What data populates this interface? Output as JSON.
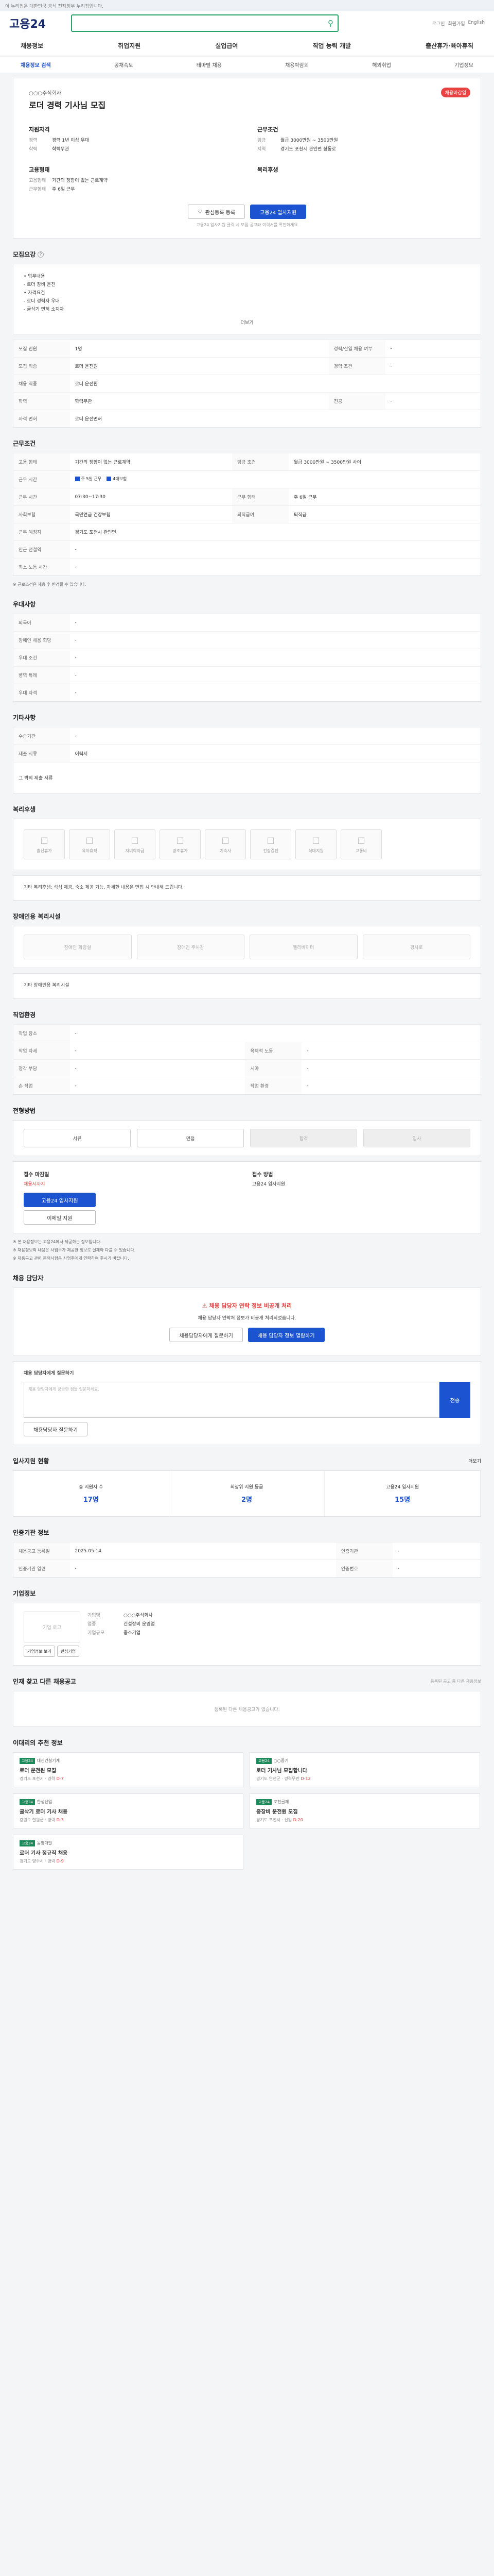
{
  "top_note": "이 누리집은 대한민국 공식 전자정부 누리집입니다.",
  "header": {
    "logo": "고용24",
    "util": [
      "로그인",
      "회원가입",
      "English"
    ]
  },
  "menu": [
    "채용정보",
    "취업지원",
    "실업급여",
    "직업 능력 개발",
    "출산휴가·육아휴직"
  ],
  "submenu": [
    "채용정보 검색",
    "공채속보",
    "테마별 채용",
    "채용박람회",
    "해외취업",
    "기업정보"
  ],
  "job": {
    "company": "○○○주식회사",
    "title": "로더 경력 기사님 모집",
    "badge": "채용마감일",
    "summary_left_title": "지원자격",
    "summary_right_title": "근무조건",
    "left": [
      {
        "k": "경력",
        "v": "경력 1년 이상 우대"
      },
      {
        "k": "학력",
        "v": "학력무관"
      }
    ],
    "right": [
      {
        "k": "임금",
        "v": "월급 3000만원 ~ 3500만원"
      },
      {
        "k": "지역",
        "v": "경기도 포천시 관인면 창동로"
      }
    ],
    "employ_title": "고용형태",
    "welfare_title": "복리후생",
    "employ": [
      {
        "k": "고용형태",
        "v": "기간의 정함이 없는 근로계약"
      },
      {
        "k": "근무형태",
        "v": "주 6일 근무"
      }
    ],
    "btn_save": "관심등록 등록",
    "btn_apply": "고용24 입사지원",
    "small": "고용24 입사지원 클릭 시 모집 공고와 이력서를 확인하세요"
  },
  "sections": {
    "recruit": "모집요강",
    "work": "근무조건",
    "detail": "우대사항",
    "other": "기타사항",
    "welfare": "복리후생",
    "disabled": "장애인용 복리시설",
    "contact": "직업환경",
    "process": "전형방법",
    "manager": "채용 담당자",
    "stat": "입사지원 현황",
    "info": "인증기관 정보",
    "corp": "기업정보",
    "others": "인재 찾고 다른 채용공고",
    "rec": "이대리의 추천 정보"
  },
  "recruit": {
    "list": [
      "• 업무내용",
      "  - 로더 장비 운전",
      "• 자격요건",
      "  - 로더 경력자 우대",
      "  - 굴삭기 면허 소지자"
    ],
    "more": "더보기",
    "rows": [
      [
        "모집 인원",
        "1명",
        "경력/신입 채용 여부",
        "-"
      ],
      [
        "모집 직종",
        "로더 운전원",
        "경력 조건",
        "-"
      ],
      [
        "채용 직종",
        "로더 운전원",
        "",
        ""
      ],
      [
        "학력",
        "학력무관",
        "전공",
        "-"
      ],
      [
        "자격 면허",
        "로더 운전면허",
        "",
        ""
      ]
    ]
  },
  "work": {
    "rows": [
      [
        "고용 형태",
        "기간의 정함이 없는 근로계약",
        "임금 조건",
        "월급 3000만원 ~ 3500만원 사이"
      ],
      [
        "근무 시간",
        "주 6일 근무",
        "",
        ""
      ],
      [
        "근무 시간",
        "07:30~17:30",
        "근무 형태",
        "주 6일 근무"
      ],
      [
        "사회보험",
        "국민연금 건강보험",
        "퇴직급여",
        "퇴직금"
      ],
      [
        "근무 예정지",
        "경기도 포천시 관인면",
        "",
        ""
      ],
      [
        "인근 전철역",
        "-",
        "",
        ""
      ],
      [
        "최소 노동 시간",
        "-",
        "",
        ""
      ]
    ],
    "note": "※ 근로조건은 채용 후 변경될 수 있습니다.",
    "chip1": "주 5일 근무",
    "chip2": "4대보험"
  },
  "detail": {
    "rows": [
      [
        "외국어",
        "-"
      ],
      [
        "장애인 채용 희망",
        "-"
      ],
      [
        "우대 조건",
        "-"
      ],
      [
        "병역 특례",
        "-"
      ],
      [
        "우대 자격",
        "-"
      ]
    ]
  },
  "other": {
    "rows": [
      [
        "수습기간",
        "-"
      ],
      [
        "제출 서류",
        "이력서"
      ]
    ],
    "extra": "그 밖의 제출 서류"
  },
  "welfare": {
    "icons": [
      "출산휴가",
      "육아휴직",
      "자녀학자금",
      "경조휴가",
      "기숙사",
      "건강검진",
      "식대지원",
      "교통비"
    ],
    "desc": "기타 복리후생: 석식 제공, 숙소 제공 가능. 자세한 내용은 면접 시 안내해 드립니다."
  },
  "disabled": {
    "icons": [
      "장애인 화장실",
      "장애인 주차장",
      "엘리베이터",
      "경사로"
    ],
    "note": "기타 장애인용 복리시설"
  },
  "contact": {
    "rows": [
      [
        "작업 장소",
        "-",
        "",
        ""
      ],
      [
        "작업 자세",
        "-",
        "육체적 노동",
        "-"
      ],
      [
        "청각 부담",
        "-",
        "시야",
        "-"
      ],
      [
        "손 작업",
        "-",
        "작업 환경",
        "-"
      ]
    ]
  },
  "process": {
    "steps": [
      "서류",
      "면접",
      "합격",
      "입사"
    ],
    "apply_title": "접수 마감일",
    "apply_text": "채용시까지",
    "method_title": "접수 방법",
    "method": "고용24 입사지원",
    "btn": "고용24 입사지원",
    "btn2": "이메일 지원",
    "notes": [
      "※ 본 채용정보는 고용24에서 제공하는 정보입니다.",
      "※ 채용정보의 내용은 사업주가 제공한 정보로 실제와 다를 수 있습니다.",
      "※ 채용공고 관련 문의사항은 사업주에게 연락하여 주시기 바랍니다."
    ]
  },
  "manager": {
    "warn": "채용 담당자 연락 정보 비공개 처리",
    "text": "채용 담당자 연락처 정보가 비공개 처리되었습니다.",
    "btn1": "채용담당자에게 질문하기",
    "btn2": "채용 담당자 정보 열람하기"
  },
  "qa": {
    "title": "채용 담당자에게 질문하기",
    "placeholder": "채용 담당자에게 궁금한 점을 질문하세요.",
    "submit": "전송",
    "btn": "채용담당자 질문하기"
  },
  "stat": {
    "more": "더보기",
    "items": [
      {
        "k": "총 지원자 수",
        "v": "17명"
      },
      {
        "k": "최상위 지원 등급",
        "v": "2명"
      },
      {
        "k": "고용24 입사지원",
        "v": "15명"
      }
    ]
  },
  "info": {
    "rows": [
      [
        "채용공고 등록일",
        "2025.05.14",
        "인증기관",
        "-"
      ],
      [
        "인증기관 일련",
        "-",
        "인증번호",
        "-"
      ]
    ]
  },
  "corp": {
    "logo": "기업 로고",
    "btn1": "기업정보 보기",
    "btn2": "관심기업",
    "rows": [
      [
        "기업명",
        "○○○주식회사"
      ],
      [
        "업종",
        "건설장비 운영업"
      ],
      [
        "기업규모",
        "중소기업"
      ]
    ]
  },
  "others": {
    "text": "등록된 다른 채용공고가 없습니다.",
    "note": "등록된 공고 중 다른 채용정보"
  },
  "rec": [
    {
      "label": "고용24",
      "co": "대신건설기계",
      "title": "로더 운전원 모집",
      "meta": "경기도 포천시 · 경력",
      "dday": "D-7"
    },
    {
      "label": "고용24",
      "co": "○○중기",
      "title": "로더 기사님 모집합니다",
      "meta": "경기도 연천군 · 경력무관",
      "dday": "D-12"
    },
    {
      "label": "고용24",
      "co": "한성산업",
      "title": "굴삭기 로더 기사 채용",
      "meta": "강원도 철원군 · 경력",
      "dday": "D-3"
    },
    {
      "label": "고용24",
      "co": "포천골재",
      "title": "중장비 운전원 모집",
      "meta": "경기도 포천시 · 신입",
      "dday": "D-20"
    },
    {
      "label": "고용24",
      "co": "동양개발",
      "title": "로더 기사 정규직 채용",
      "meta": "경기도 양주시 · 경력",
      "dday": "D-9"
    }
  ]
}
